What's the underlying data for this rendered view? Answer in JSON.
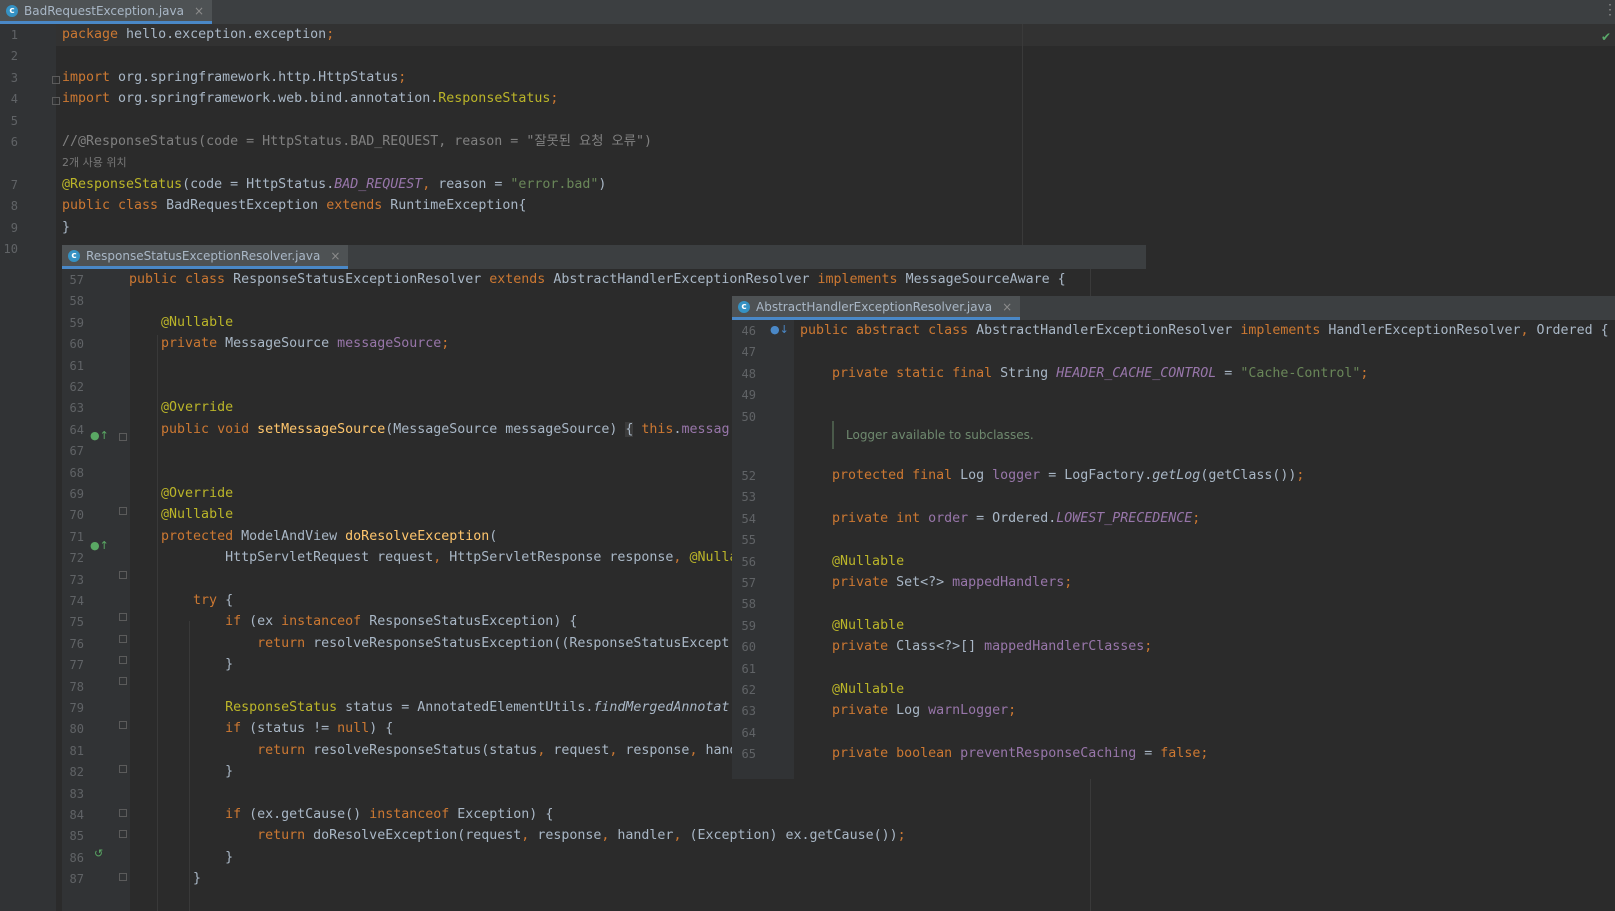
{
  "main_tab": {
    "file_name": "BadRequestException.java",
    "close": "×",
    "icon": "c"
  },
  "main_editor": {
    "lines": [
      {
        "n": "1",
        "html": "<span class=\"kw\">package</span> hello.exception.exception<span class=\"kw\">;</span>"
      },
      {
        "n": "2",
        "html": ""
      },
      {
        "n": "3",
        "html": "<span class=\"kw\">import</span> org.springframework.http.HttpStatus<span class=\"kw\">;</span>"
      },
      {
        "n": "4",
        "html": "<span class=\"kw\">import</span> org.springframework.web.bind.annotation.<span class=\"ann\">ResponseStatus</span><span class=\"kw\">;</span>"
      },
      {
        "n": "5",
        "html": ""
      },
      {
        "n": "6",
        "html": "<span class=\"cmt\">//@ResponseStatus(code = HttpStatus.BAD_REQUEST, reason = \"잘못된 요청 오류\")</span>"
      },
      {
        "n": "",
        "html": "<span class=\"hint\">2개 사용 위치</span>"
      },
      {
        "n": "7",
        "html": "<span class=\"ann\">@ResponseStatus</span>(code = HttpStatus.<span class=\"fld ital\">BAD_REQUEST</span><span class=\"kw\">,</span> reason = <span class=\"str\">\"error.bad\"</span>)"
      },
      {
        "n": "8",
        "html": "<span class=\"kw\">public class</span> BadRequestException <span class=\"kw\">extends</span> RuntimeException{"
      },
      {
        "n": "9",
        "html": "}"
      },
      {
        "n": "10",
        "html": ""
      }
    ]
  },
  "popup_a": {
    "file_name": "ResponseStatusExceptionResolver.java",
    "close": "×",
    "icon": "c",
    "lines": [
      {
        "n": "57",
        "html": "<span class=\"kw\">public class</span> ResponseStatusExceptionResolver <span class=\"kw\">extends</span> AbstractHandlerExceptionResolver <span class=\"kw\">implements</span> MessageSourceAware {"
      },
      {
        "n": "58",
        "html": ""
      },
      {
        "n": "59",
        "html": "    <span class=\"ann\">@Nullable</span>"
      },
      {
        "n": "60",
        "html": "    <span class=\"kw\">private</span> MessageSource <span class=\"fld\">messageSource</span><span class=\"kw\">;</span>"
      },
      {
        "n": "61",
        "html": ""
      },
      {
        "n": "62",
        "html": ""
      },
      {
        "n": "63",
        "html": "    <span class=\"ann\">@Override</span>"
      },
      {
        "n": "64",
        "html": "    <span class=\"kw\">public void</span> <span class=\"fn\">setMessageSource</span>(MessageSource messageSource) <span style=\"background:#3b3b3b\">{</span> <span class=\"kw\">this</span>.<span class=\"fld\">messag</span>"
      },
      {
        "n": "67",
        "html": ""
      },
      {
        "n": "68",
        "html": ""
      },
      {
        "n": "69",
        "html": "    <span class=\"ann\">@Override</span>"
      },
      {
        "n": "70",
        "html": "    <span class=\"ann\">@Nullable</span>"
      },
      {
        "n": "71",
        "html": "    <span class=\"kw\">protected</span> ModelAndView <span class=\"fn\">doResolveException</span>("
      },
      {
        "n": "72",
        "html": "            HttpServletRequest request<span class=\"kw\">,</span> HttpServletResponse response<span class=\"kw\">,</span> <span class=\"ann\">@Nulla</span>"
      },
      {
        "n": "73",
        "html": ""
      },
      {
        "n": "74",
        "html": "        <span class=\"kw\">try</span> {"
      },
      {
        "n": "75",
        "html": "            <span class=\"kw\">if</span> (ex <span class=\"kw\">instanceof</span> ResponseStatusException) {"
      },
      {
        "n": "76",
        "html": "                <span class=\"kw\">return</span> resolveResponseStatusException((ResponseStatusExcept"
      },
      {
        "n": "77",
        "html": "            }"
      },
      {
        "n": "78",
        "html": ""
      },
      {
        "n": "79",
        "html": "            <span class=\"ann\">ResponseStatus</span> status = AnnotatedElementUtils.<span class=\"ital\">findMergedAnnotat</span>"
      },
      {
        "n": "80",
        "html": "            <span class=\"kw\">if</span> (status != <span class=\"kw\">null</span>) {"
      },
      {
        "n": "81",
        "html": "                <span class=\"kw\">return</span> resolveResponseStatus(status<span class=\"kw\">,</span> request<span class=\"kw\">,</span> response<span class=\"kw\">,</span> hand"
      },
      {
        "n": "82",
        "html": "            }"
      },
      {
        "n": "83",
        "html": ""
      },
      {
        "n": "84",
        "html": "            <span class=\"kw\">if</span> (ex.getCause() <span class=\"kw\">instanceof</span> Exception) {"
      },
      {
        "n": "85",
        "html": "                <span class=\"kw\">return</span> doResolveException(request<span class=\"kw\">,</span> response<span class=\"kw\">,</span> handler<span class=\"kw\">,</span> (Exception) ex.getCause())<span class=\"kw\">;</span>"
      },
      {
        "n": "86",
        "html": "            }"
      },
      {
        "n": "87",
        "html": "        }"
      }
    ]
  },
  "popup_b": {
    "file_name": "AbstractHandlerExceptionResolver.java",
    "close": "×",
    "icon": "c",
    "doc_comment": "Logger available to subclasses.",
    "lines": [
      {
        "n": "46",
        "html": "<span class=\"kw\">public abstract class</span> AbstractHandlerExceptionResolver <span class=\"kw\">implements</span> HandlerExceptionResolver<span class=\"kw\">,</span> Ordered {"
      },
      {
        "n": "47",
        "html": ""
      },
      {
        "n": "48",
        "html": "    <span class=\"kw\">private static final</span> String <span class=\"fld ital\">HEADER_CACHE_CONTROL</span> = <span class=\"str\">\"Cache-Control\"</span><span class=\"kw\">;</span>"
      },
      {
        "n": "49",
        "html": ""
      },
      {
        "n": "50",
        "html": ""
      },
      {
        "n": "",
        "html": ""
      },
      {
        "n": "52",
        "html": "    <span class=\"kw\">protected final</span> Log <span class=\"fld\">logger</span> = LogFactory.<span class=\"ital\">getLog</span>(getClass())<span class=\"kw\">;</span>"
      },
      {
        "n": "53",
        "html": ""
      },
      {
        "n": "54",
        "html": "    <span class=\"kw\">private int</span> <span class=\"fld\">order</span> = Ordered.<span class=\"fld ital\">LOWEST_PRECEDENCE</span><span class=\"kw\">;</span>"
      },
      {
        "n": "55",
        "html": ""
      },
      {
        "n": "56",
        "html": "    <span class=\"ann\">@Nullable</span>"
      },
      {
        "n": "57",
        "html": "    <span class=\"kw\">private</span> Set&lt;?&gt; <span class=\"fld\">mappedHandlers</span><span class=\"kw\">;</span>"
      },
      {
        "n": "58",
        "html": ""
      },
      {
        "n": "59",
        "html": "    <span class=\"ann\">@Nullable</span>"
      },
      {
        "n": "60",
        "html": "    <span class=\"kw\">private</span> Class&lt;?&gt;[] <span class=\"fld\">mappedHandlerClasses</span><span class=\"kw\">;</span>"
      },
      {
        "n": "61",
        "html": ""
      },
      {
        "n": "62",
        "html": "    <span class=\"ann\">@Nullable</span>"
      },
      {
        "n": "63",
        "html": "    <span class=\"kw\">private</span> Log <span class=\"fld\">warnLogger</span><span class=\"kw\">;</span>"
      },
      {
        "n": "64",
        "html": ""
      },
      {
        "n": "65",
        "html": "    <span class=\"kw\">private boolean</span> <span class=\"fld\">preventResponseCaching</span> = <span class=\"kw\">false;</span>"
      }
    ]
  },
  "colors": {
    "background": "#2b2b2b",
    "gutter": "#313335",
    "keyword": "#cc7832",
    "annotation": "#bbb529",
    "string": "#6a8759",
    "field": "#9876aa",
    "method": "#ffc66d",
    "comment": "#808080",
    "tab_accent": "#4a88c7"
  }
}
